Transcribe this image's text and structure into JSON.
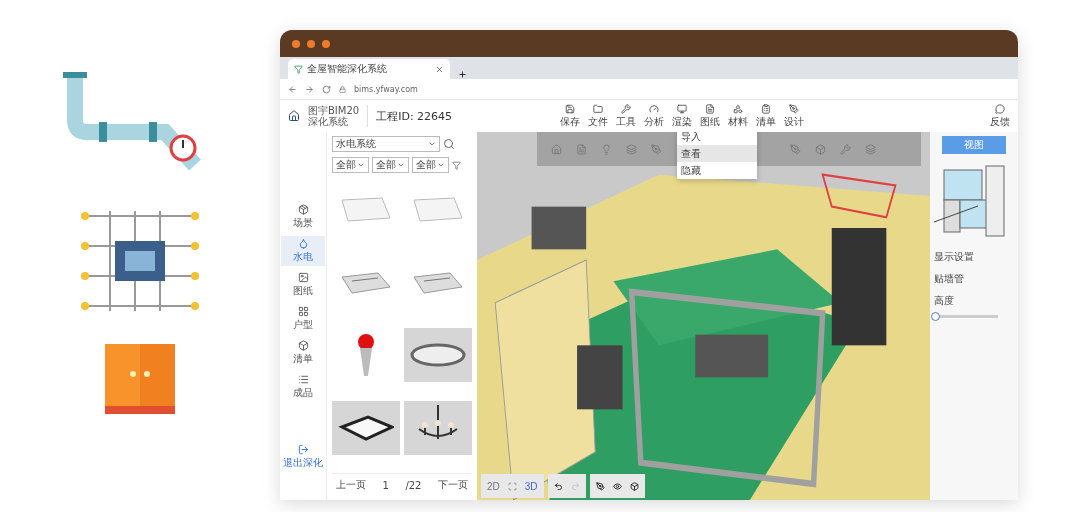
{
  "browser": {
    "tab_title": "全屋智能深化系统",
    "url": "bims.yfway.com"
  },
  "header": {
    "logo_line1": "图宇BIM20",
    "logo_line2": "深化系统",
    "project": "工程ID: 22645",
    "tools": [
      "保存",
      "文件",
      "工具",
      "分析",
      "渲染",
      "图纸",
      "材料",
      "清单",
      "设计"
    ],
    "feedback": "反馈"
  },
  "sidebar": {
    "items": [
      {
        "label": "场景",
        "selected": false
      },
      {
        "label": "水电",
        "selected": true
      },
      {
        "label": "图纸",
        "selected": false
      },
      {
        "label": "户型",
        "selected": false
      },
      {
        "label": "清单",
        "selected": false
      },
      {
        "label": "成品",
        "selected": false
      }
    ],
    "exit": "退出深化"
  },
  "library": {
    "category": "水电系统",
    "filters": [
      "全部",
      "全部",
      "全部"
    ],
    "items": [
      {
        "kind": "panel"
      },
      {
        "kind": "panel"
      },
      {
        "kind": "vent"
      },
      {
        "kind": "vent"
      },
      {
        "kind": "lamp"
      },
      {
        "kind": "ring"
      },
      {
        "kind": "square"
      },
      {
        "kind": "chandelier"
      }
    ]
  },
  "pager": {
    "prev": "上一页",
    "page": "1",
    "total": "/22",
    "next": "下一页"
  },
  "menu": {
    "items": [
      {
        "label": "导入",
        "selected": false
      },
      {
        "label": "查看",
        "selected": true
      },
      {
        "label": "隐藏",
        "selected": false
      }
    ]
  },
  "right_panel": {
    "view_button": "视图",
    "display_label": "显示设置",
    "pipe_label": "贴墙管",
    "height_label": "高度",
    "height": {
      "level": 0.02
    }
  },
  "view_modes": [
    {
      "label": "2D",
      "selected": false
    },
    {
      "label": "3D",
      "selected": true
    }
  ]
}
